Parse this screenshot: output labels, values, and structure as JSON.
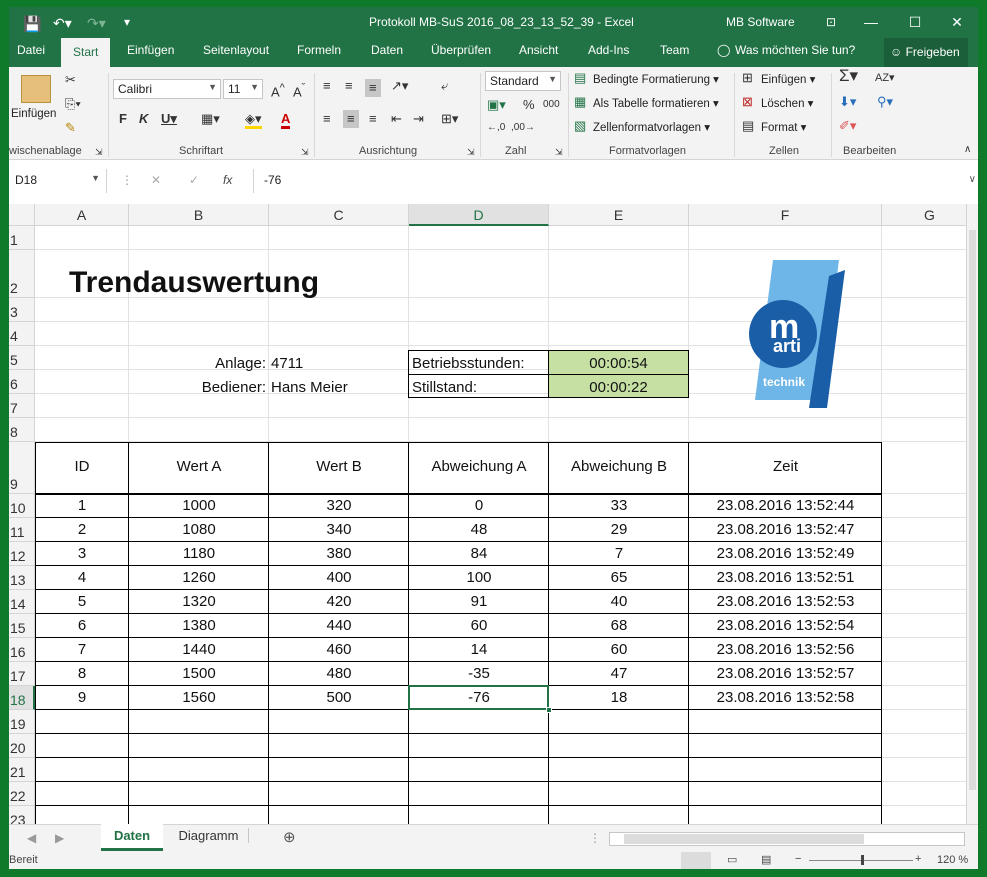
{
  "window": {
    "title": "Protokoll MB-SuS 2016_08_23_13_52_39  -  Excel",
    "account": "MB Software"
  },
  "tabs": [
    "Datei",
    "Start",
    "Einfügen",
    "Seitenlayout",
    "Formeln",
    "Daten",
    "Überprüfen",
    "Ansicht",
    "Add-Ins",
    "Team"
  ],
  "tell_me": "Was möchten Sie tun?",
  "share": "Freigeben",
  "ribbon": {
    "clipboard": {
      "paste": "Einfügen",
      "group": "wischenablage"
    },
    "font": {
      "name": "Calibri",
      "size": "11",
      "group": "Schriftart"
    },
    "align": {
      "group": "Ausrichtung"
    },
    "number": {
      "format": "Standard",
      "group": "Zahl"
    },
    "styles": {
      "cond": "Bedingte Formatierung",
      "table": "Als Tabelle formatieren",
      "cell": "Zellenformatvorlagen",
      "group": "Formatvorlagen"
    },
    "cells": {
      "insert": "Einfügen",
      "delete": "Löschen",
      "format": "Format",
      "group": "Zellen"
    },
    "editing": {
      "group": "Bearbeiten"
    }
  },
  "formula_bar": {
    "name_box": "D18",
    "fx": "fx",
    "value": "-76"
  },
  "columns": [
    "A",
    "B",
    "C",
    "D",
    "E",
    "F",
    "G"
  ],
  "rows": [
    "1",
    "2",
    "3",
    "4",
    "5",
    "6",
    "7",
    "8",
    "9",
    "10",
    "11",
    "12",
    "13",
    "14",
    "15",
    "16",
    "17",
    "18",
    "19",
    "20",
    "21",
    "22",
    "23"
  ],
  "sheet": {
    "title": "Trendauswertung",
    "anlage_label": "Anlage:",
    "anlage_value": "4711",
    "bediener_label": "Bediener:",
    "bediener_value": "Hans Meier",
    "betrieb_label": "Betriebsstunden:",
    "betrieb_value": "00:00:54",
    "still_label": "Stillstand:",
    "still_value": "00:00:22",
    "logo_text": [
      "m",
      "arti",
      "technik"
    ],
    "headers": [
      "ID",
      "Wert A",
      "Wert B",
      "Abweichung A",
      "Abweichung B",
      "Zeit"
    ],
    "data": [
      [
        "1",
        "1000",
        "320",
        "0",
        "33",
        "23.08.2016 13:52:44"
      ],
      [
        "2",
        "1080",
        "340",
        "48",
        "29",
        "23.08.2016 13:52:47"
      ],
      [
        "3",
        "1180",
        "380",
        "84",
        "7",
        "23.08.2016 13:52:49"
      ],
      [
        "4",
        "1260",
        "400",
        "100",
        "65",
        "23.08.2016 13:52:51"
      ],
      [
        "5",
        "1320",
        "420",
        "91",
        "40",
        "23.08.2016 13:52:53"
      ],
      [
        "6",
        "1380",
        "440",
        "60",
        "68",
        "23.08.2016 13:52:54"
      ],
      [
        "7",
        "1440",
        "460",
        "14",
        "60",
        "23.08.2016 13:52:56"
      ],
      [
        "8",
        "1500",
        "480",
        "-35",
        "47",
        "23.08.2016 13:52:57"
      ],
      [
        "9",
        "1560",
        "500",
        "-76",
        "18",
        "23.08.2016 13:52:58"
      ]
    ]
  },
  "sheet_tabs": [
    "Daten",
    "Diagramm"
  ],
  "status": {
    "ready": "Bereit",
    "zoom": "120 %"
  },
  "colors": {
    "accent": "#217346",
    "fill": "#c6e0a4"
  }
}
